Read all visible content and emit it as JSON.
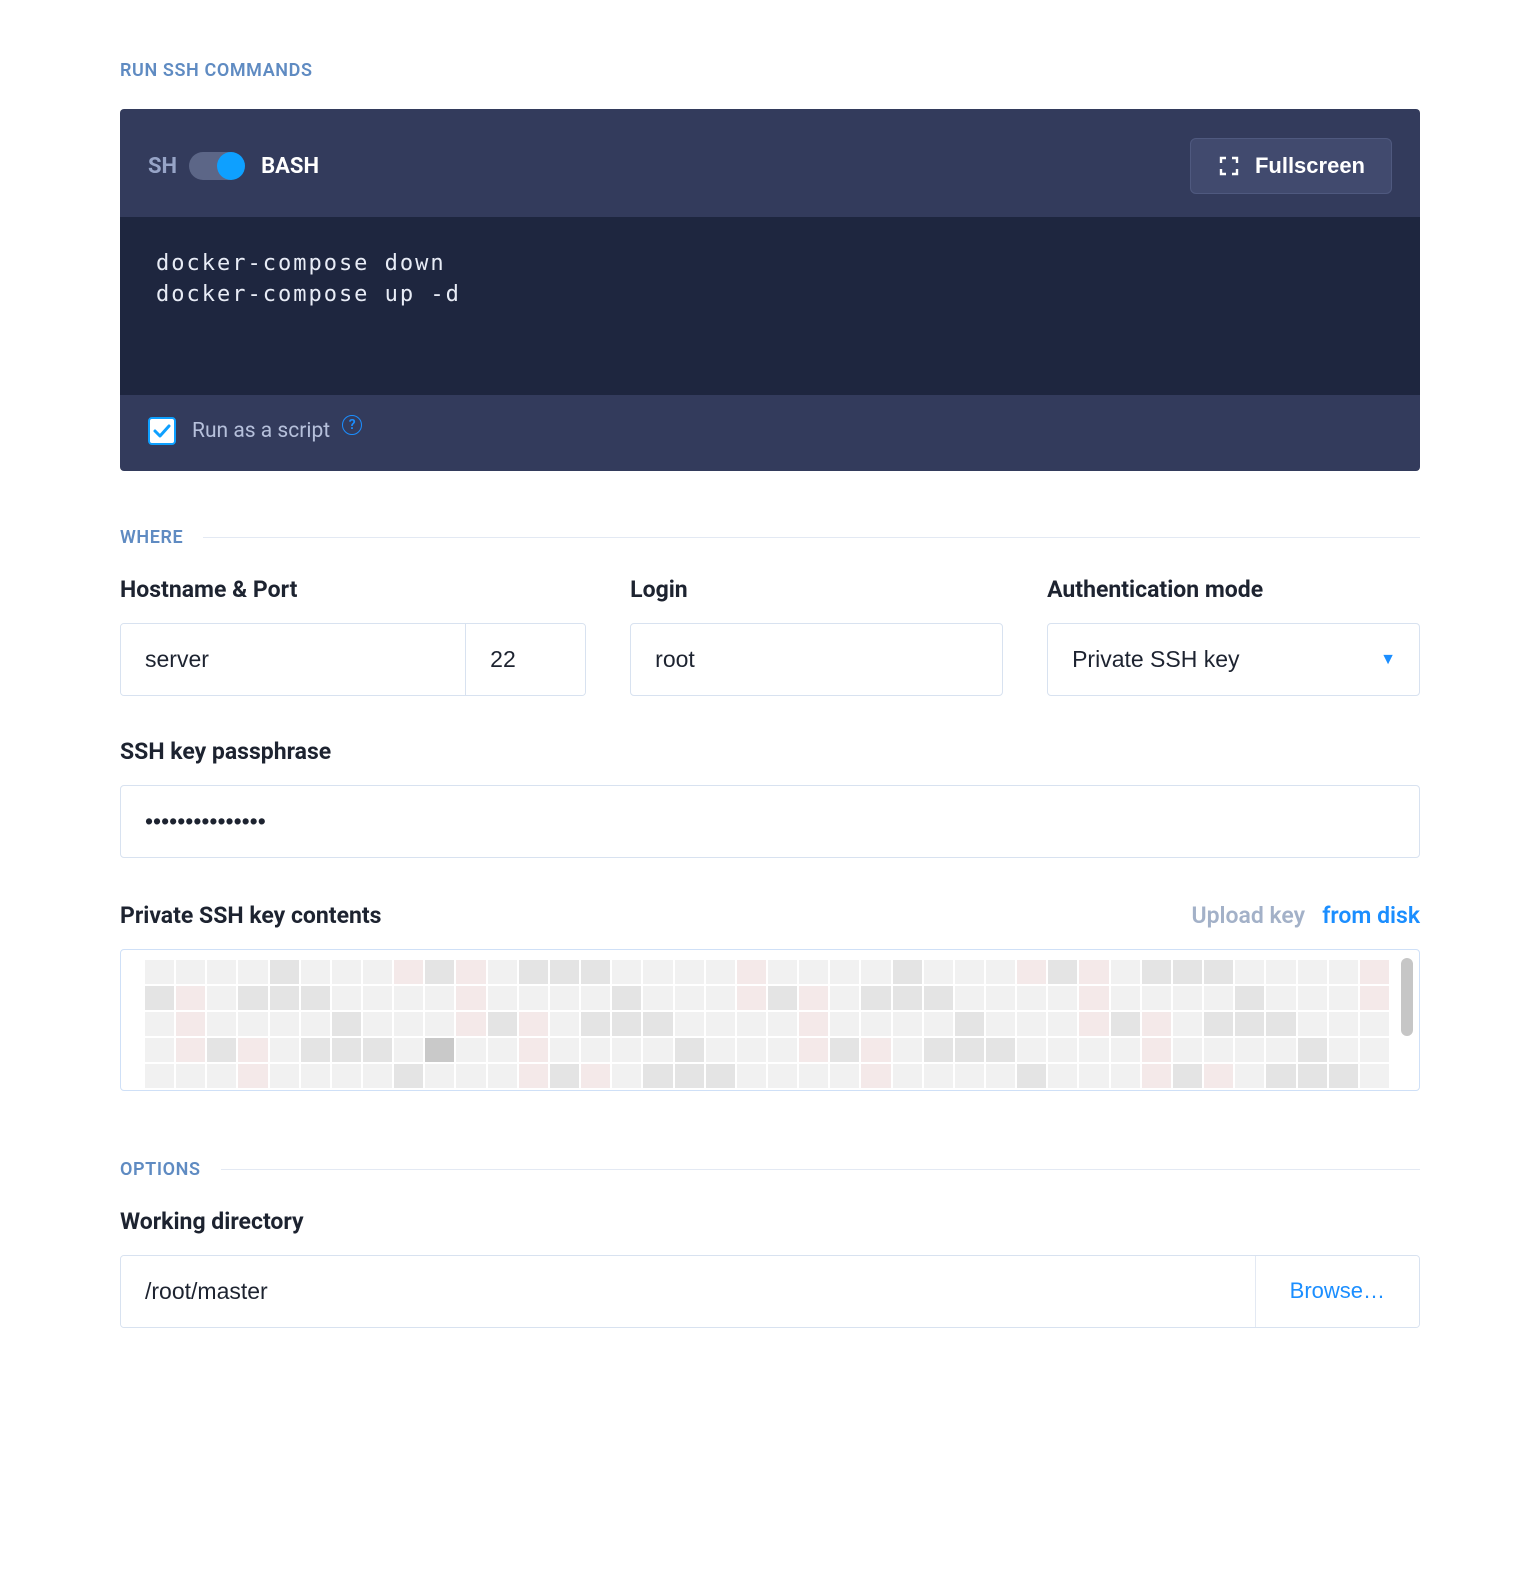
{
  "sections": {
    "run_ssh": "RUN SSH COMMANDS",
    "where": "WHERE",
    "options": "OPTIONS"
  },
  "editor": {
    "sh_label": "SH",
    "bash_label": "BASH",
    "fullscreen_label": "Fullscreen",
    "code": "docker-compose down\ndocker-compose up -d",
    "run_as_script_label": "Run as a script",
    "run_as_script_checked": true
  },
  "where": {
    "hostname_port_label": "Hostname & Port",
    "hostname_value": "server",
    "port_value": "22",
    "login_label": "Login",
    "login_value": "root",
    "auth_mode_label": "Authentication mode",
    "auth_mode_value": "Private SSH key",
    "passphrase_label": "SSH key passphrase",
    "passphrase_value": "•••••••••••••••",
    "ssh_key_label": "Private SSH key contents",
    "upload_prefix": "Upload key",
    "upload_link": "from disk"
  },
  "options": {
    "working_directory_label": "Working directory",
    "working_directory_value": "/root/master",
    "browse_label": "Browse…"
  }
}
